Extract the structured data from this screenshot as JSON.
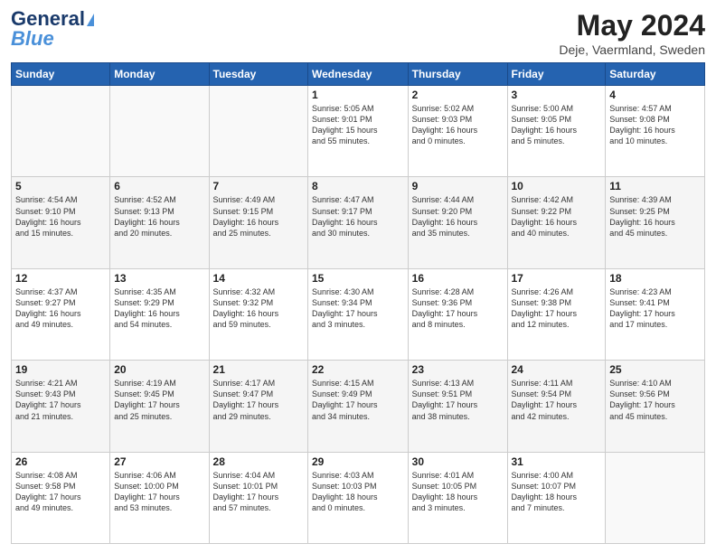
{
  "header": {
    "logo_line1": "General",
    "logo_line2": "Blue",
    "title": "May 2024",
    "subtitle": "Deje, Vaermland, Sweden"
  },
  "days_of_week": [
    "Sunday",
    "Monday",
    "Tuesday",
    "Wednesday",
    "Thursday",
    "Friday",
    "Saturday"
  ],
  "weeks": [
    [
      {
        "day": "",
        "content": ""
      },
      {
        "day": "",
        "content": ""
      },
      {
        "day": "",
        "content": ""
      },
      {
        "day": "1",
        "content": "Sunrise: 5:05 AM\nSunset: 9:01 PM\nDaylight: 15 hours\nand 55 minutes."
      },
      {
        "day": "2",
        "content": "Sunrise: 5:02 AM\nSunset: 9:03 PM\nDaylight: 16 hours\nand 0 minutes."
      },
      {
        "day": "3",
        "content": "Sunrise: 5:00 AM\nSunset: 9:05 PM\nDaylight: 16 hours\nand 5 minutes."
      },
      {
        "day": "4",
        "content": "Sunrise: 4:57 AM\nSunset: 9:08 PM\nDaylight: 16 hours\nand 10 minutes."
      }
    ],
    [
      {
        "day": "5",
        "content": "Sunrise: 4:54 AM\nSunset: 9:10 PM\nDaylight: 16 hours\nand 15 minutes."
      },
      {
        "day": "6",
        "content": "Sunrise: 4:52 AM\nSunset: 9:13 PM\nDaylight: 16 hours\nand 20 minutes."
      },
      {
        "day": "7",
        "content": "Sunrise: 4:49 AM\nSunset: 9:15 PM\nDaylight: 16 hours\nand 25 minutes."
      },
      {
        "day": "8",
        "content": "Sunrise: 4:47 AM\nSunset: 9:17 PM\nDaylight: 16 hours\nand 30 minutes."
      },
      {
        "day": "9",
        "content": "Sunrise: 4:44 AM\nSunset: 9:20 PM\nDaylight: 16 hours\nand 35 minutes."
      },
      {
        "day": "10",
        "content": "Sunrise: 4:42 AM\nSunset: 9:22 PM\nDaylight: 16 hours\nand 40 minutes."
      },
      {
        "day": "11",
        "content": "Sunrise: 4:39 AM\nSunset: 9:25 PM\nDaylight: 16 hours\nand 45 minutes."
      }
    ],
    [
      {
        "day": "12",
        "content": "Sunrise: 4:37 AM\nSunset: 9:27 PM\nDaylight: 16 hours\nand 49 minutes."
      },
      {
        "day": "13",
        "content": "Sunrise: 4:35 AM\nSunset: 9:29 PM\nDaylight: 16 hours\nand 54 minutes."
      },
      {
        "day": "14",
        "content": "Sunrise: 4:32 AM\nSunset: 9:32 PM\nDaylight: 16 hours\nand 59 minutes."
      },
      {
        "day": "15",
        "content": "Sunrise: 4:30 AM\nSunset: 9:34 PM\nDaylight: 17 hours\nand 3 minutes."
      },
      {
        "day": "16",
        "content": "Sunrise: 4:28 AM\nSunset: 9:36 PM\nDaylight: 17 hours\nand 8 minutes."
      },
      {
        "day": "17",
        "content": "Sunrise: 4:26 AM\nSunset: 9:38 PM\nDaylight: 17 hours\nand 12 minutes."
      },
      {
        "day": "18",
        "content": "Sunrise: 4:23 AM\nSunset: 9:41 PM\nDaylight: 17 hours\nand 17 minutes."
      }
    ],
    [
      {
        "day": "19",
        "content": "Sunrise: 4:21 AM\nSunset: 9:43 PM\nDaylight: 17 hours\nand 21 minutes."
      },
      {
        "day": "20",
        "content": "Sunrise: 4:19 AM\nSunset: 9:45 PM\nDaylight: 17 hours\nand 25 minutes."
      },
      {
        "day": "21",
        "content": "Sunrise: 4:17 AM\nSunset: 9:47 PM\nDaylight: 17 hours\nand 29 minutes."
      },
      {
        "day": "22",
        "content": "Sunrise: 4:15 AM\nSunset: 9:49 PM\nDaylight: 17 hours\nand 34 minutes."
      },
      {
        "day": "23",
        "content": "Sunrise: 4:13 AM\nSunset: 9:51 PM\nDaylight: 17 hours\nand 38 minutes."
      },
      {
        "day": "24",
        "content": "Sunrise: 4:11 AM\nSunset: 9:54 PM\nDaylight: 17 hours\nand 42 minutes."
      },
      {
        "day": "25",
        "content": "Sunrise: 4:10 AM\nSunset: 9:56 PM\nDaylight: 17 hours\nand 45 minutes."
      }
    ],
    [
      {
        "day": "26",
        "content": "Sunrise: 4:08 AM\nSunset: 9:58 PM\nDaylight: 17 hours\nand 49 minutes."
      },
      {
        "day": "27",
        "content": "Sunrise: 4:06 AM\nSunset: 10:00 PM\nDaylight: 17 hours\nand 53 minutes."
      },
      {
        "day": "28",
        "content": "Sunrise: 4:04 AM\nSunset: 10:01 PM\nDaylight: 17 hours\nand 57 minutes."
      },
      {
        "day": "29",
        "content": "Sunrise: 4:03 AM\nSunset: 10:03 PM\nDaylight: 18 hours\nand 0 minutes."
      },
      {
        "day": "30",
        "content": "Sunrise: 4:01 AM\nSunset: 10:05 PM\nDaylight: 18 hours\nand 3 minutes."
      },
      {
        "day": "31",
        "content": "Sunrise: 4:00 AM\nSunset: 10:07 PM\nDaylight: 18 hours\nand 7 minutes."
      },
      {
        "day": "",
        "content": ""
      }
    ]
  ]
}
